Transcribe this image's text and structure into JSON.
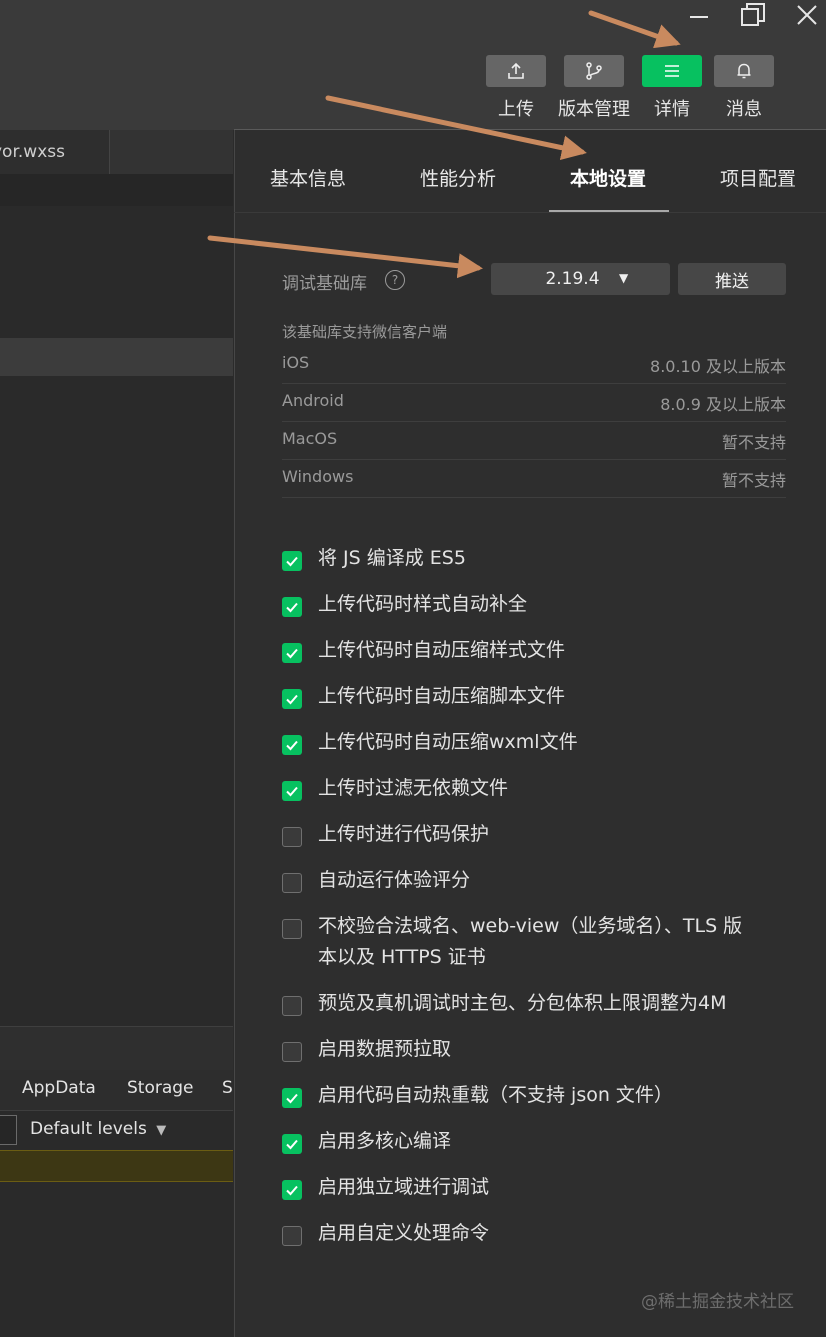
{
  "window": {
    "minimize_icon": "minimize-icon",
    "restore_icon": "restore-icon",
    "close_icon": "close-icon"
  },
  "toolbar": {
    "upload": "上传",
    "version": "版本管理",
    "details": "详情",
    "messages": "消息"
  },
  "editor": {
    "file_tab": "yor.wxss"
  },
  "devtools": {
    "tabs": [
      "AppData",
      "Storage",
      "S"
    ],
    "levels": "Default levels"
  },
  "panel": {
    "tabs": [
      "基本信息",
      "性能分析",
      "本地设置",
      "项目配置"
    ],
    "active_tab": "本地设置",
    "sdk_label": "调试基础库",
    "sdk_version": "2.19.4",
    "push_label": "推送",
    "support_title": "该基础库支持微信客户端",
    "support": [
      {
        "name": "iOS",
        "value": "8.0.10 及以上版本"
      },
      {
        "name": "Android",
        "value": "8.0.9 及以上版本"
      },
      {
        "name": "MacOS",
        "value": "暂不支持"
      },
      {
        "name": "Windows",
        "value": "暂不支持"
      }
    ],
    "options": [
      {
        "label": "将 JS 编译成 ES5",
        "checked": true
      },
      {
        "label": "上传代码时样式自动补全",
        "checked": true
      },
      {
        "label": "上传代码时自动压缩样式文件",
        "checked": true
      },
      {
        "label": "上传代码时自动压缩脚本文件",
        "checked": true
      },
      {
        "label": "上传代码时自动压缩wxml文件",
        "checked": true
      },
      {
        "label": "上传时过滤无依赖文件",
        "checked": true
      },
      {
        "label": "上传时进行代码保护",
        "checked": false
      },
      {
        "label": "自动运行体验评分",
        "checked": false
      },
      {
        "label": "不校验合法域名、web-view（业务域名）、TLS 版本以及 HTTPS 证书",
        "checked": false
      },
      {
        "label": "预览及真机调试时主包、分包体积上限调整为4M",
        "checked": false
      },
      {
        "label": "启用数据预拉取",
        "checked": false
      },
      {
        "label": "启用代码自动热重载（不支持 json 文件）",
        "checked": true
      },
      {
        "label": "启用多核心编译",
        "checked": true
      },
      {
        "label": "启用独立域进行调试",
        "checked": true
      },
      {
        "label": "启用自定义处理命令",
        "checked": false
      }
    ]
  },
  "watermark": "@稀土掘金技术社区",
  "colors": {
    "accent_green": "#07c160",
    "annotation_arrow": "#c98a5f",
    "panel_bg": "#2e2e2e"
  }
}
